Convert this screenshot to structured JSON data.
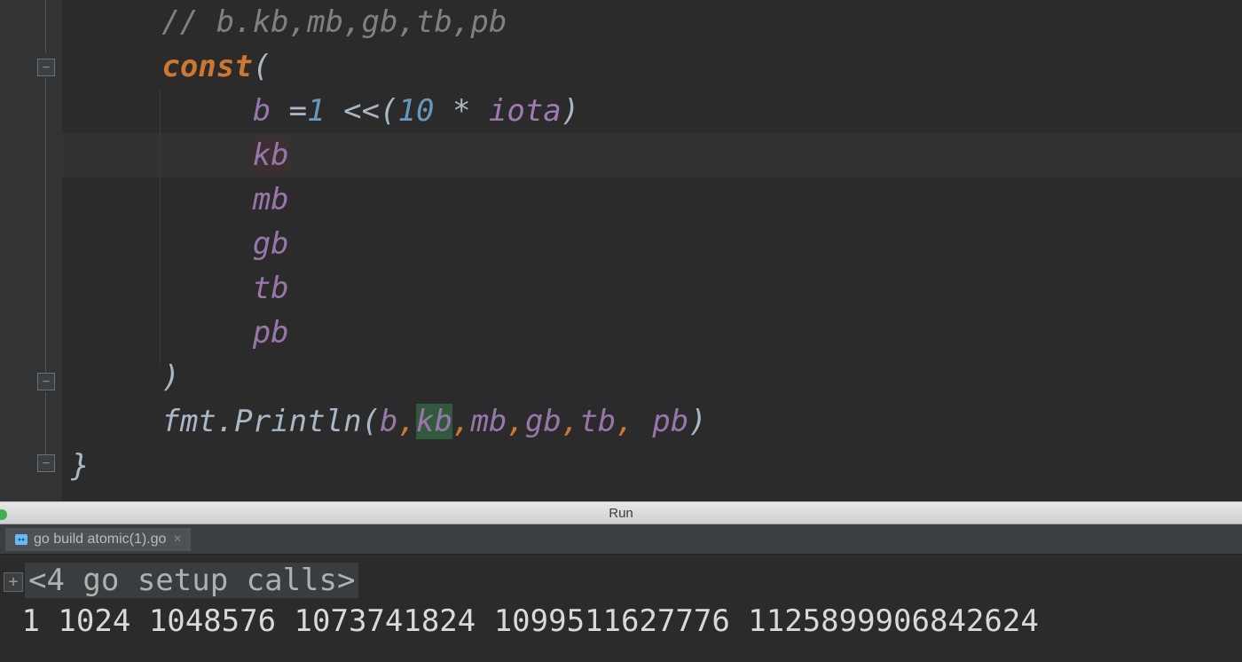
{
  "editor": {
    "comment": "// b.kb,mb,gb,tb,pb",
    "const_kw": "const",
    "open_paren": "(",
    "line_b_ident": "b",
    "line_b_eq": " =",
    "line_b_num1": "1",
    "line_b_shift": " <<(",
    "line_b_num10": "10",
    "line_b_star": " * ",
    "line_b_iota": "iota",
    "line_b_close": ")",
    "id_kb": "kb",
    "id_mb": "mb",
    "id_gb": "gb",
    "id_tb": "tb",
    "id_pb": "pb",
    "close_paren": ")",
    "fmt": "fmt",
    "dot": ".",
    "println": "Println",
    "call_open": "(",
    "arg_b": "b",
    "c1": ",",
    "arg_kb": "kb",
    "c2": ",",
    "arg_mb": "mb",
    "c3": ",",
    "arg_gb": "gb",
    "c4": ",",
    "arg_tb": "tb",
    "c5": ", ",
    "arg_pb": "pb",
    "call_close": ")",
    "brace_close": "}"
  },
  "divider": {
    "label": "Run"
  },
  "run": {
    "tab_label": "go build atomic(1).go",
    "tab_close": "×",
    "folded": "<4 go setup calls>",
    "output": "1 1024 1048576 1073741824 1099511627776 1125899906842624"
  }
}
